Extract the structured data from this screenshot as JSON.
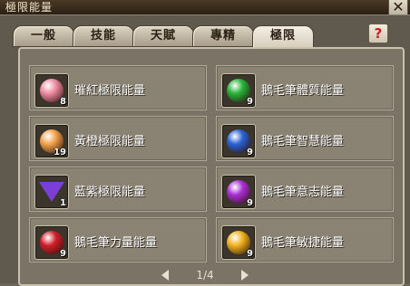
{
  "window": {
    "title": "極限能量",
    "close": "✕",
    "help": "?"
  },
  "tabs": [
    "一般",
    "技能",
    "天賦",
    "專精",
    "極限"
  ],
  "active_tab": "極限",
  "items": [
    {
      "name": "璀紅極限能量",
      "qty": "8",
      "icon": "pink-orb-icon",
      "color": "#f08aa4"
    },
    {
      "name": "鵝毛筆體質能量",
      "qty": "9",
      "icon": "green-orb-icon",
      "color": "#27b33a"
    },
    {
      "name": "黃橙極限能量",
      "qty": "19",
      "icon": "orange-orb-icon",
      "color": "#f3a24c"
    },
    {
      "name": "鵝毛筆智慧能量",
      "qty": "9",
      "icon": "blue-orb-icon",
      "color": "#2a62d6"
    },
    {
      "name": "藍紫極限能量",
      "qty": "1",
      "icon": "purple-gem-icon",
      "color": "#7a3fd6"
    },
    {
      "name": "鵝毛筆意志能量",
      "qty": "9",
      "icon": "purple-orb-icon",
      "color": "#a92fd3"
    },
    {
      "name": "鵝毛筆力量能量",
      "qty": "9",
      "icon": "red-orb-icon",
      "color": "#d11f2a"
    },
    {
      "name": "鵝毛筆敏捷能量",
      "qty": "9",
      "icon": "gold-orb-icon",
      "color": "#f0b320"
    }
  ],
  "pager": {
    "text": "1/4"
  }
}
